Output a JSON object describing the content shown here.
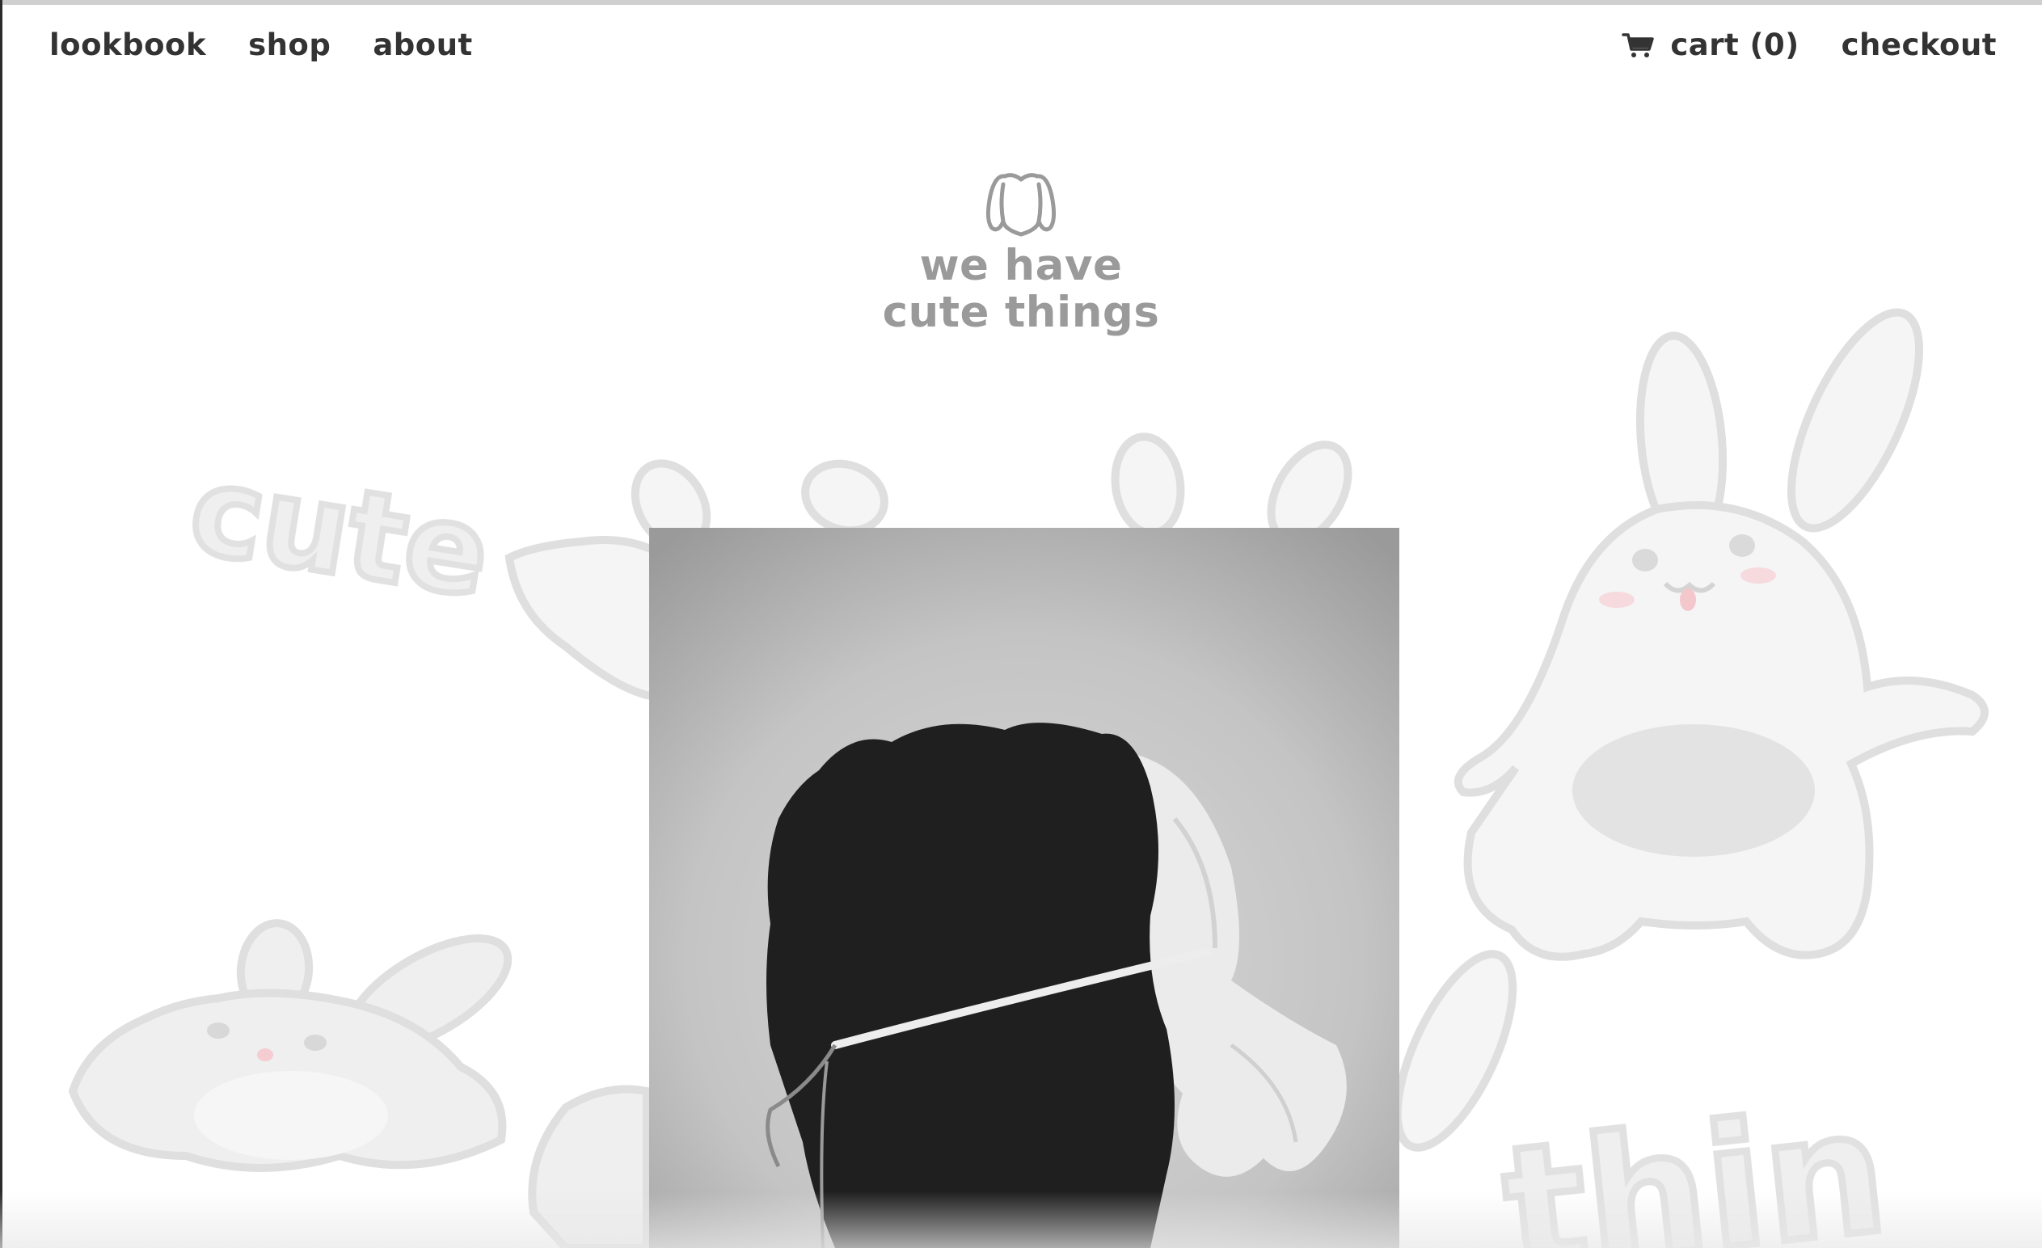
{
  "nav": {
    "left_items": [
      "lookbook",
      "shop",
      "about"
    ],
    "cart_label": "cart (0)",
    "checkout_label": "checkout",
    "cart_icon": "shopping-cart-icon"
  },
  "logo": {
    "icon": "bunny-head-icon",
    "line1": "we have",
    "line2": "cute things"
  },
  "background": {
    "words": [
      "cute",
      "thin"
    ]
  },
  "colors": {
    "nav_text": "#333333",
    "logo_gray": "#9a9a9a",
    "background": "#ffffff",
    "art_fill": "#f2f2f2",
    "art_stroke": "#dcdcdc",
    "blush": "#f3c7cc"
  }
}
